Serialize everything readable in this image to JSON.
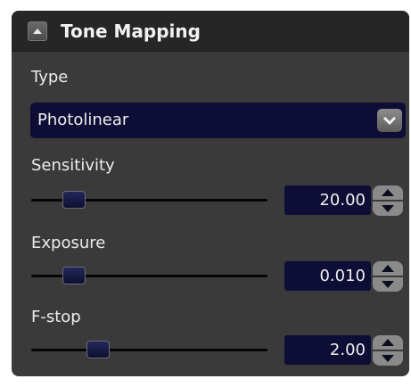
{
  "panel": {
    "title": "Tone Mapping",
    "collapse_icon": "triangle-up-icon"
  },
  "type": {
    "label": "Type",
    "selected": "Photolinear",
    "arrow_icon": "chevron-down-icon"
  },
  "sliders": [
    {
      "label": "Sensitivity",
      "value": "20.00",
      "position": 0.08
    },
    {
      "label": "Exposure",
      "value": "0.010",
      "position": 0.08
    },
    {
      "label": "F-stop",
      "value": "2.00",
      "position": 0.18
    }
  ],
  "colors": {
    "panel_bg": "#3a3a3a",
    "header_bg": "#262626",
    "field_bg": "#0d0d35",
    "text": "#f0f0f0"
  }
}
